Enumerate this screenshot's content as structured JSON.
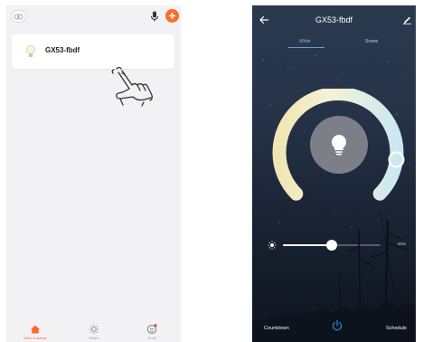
{
  "left_screen": {
    "device": {
      "name": "GX53-fbdf"
    },
    "nav": [
      {
        "label": "Mein Zuhause",
        "icon": "home-icon",
        "active": true
      },
      {
        "label": "Smart",
        "icon": "smart-icon",
        "active": false
      },
      {
        "label": "Profil",
        "icon": "profile-icon",
        "active": false
      }
    ]
  },
  "right_screen": {
    "title": "GX53-fbdf",
    "tabs": [
      "White",
      "Scene"
    ],
    "brightness": {
      "value": 0.5,
      "label": "50%"
    },
    "color_temperature": 0.86,
    "footer": {
      "countdown": "Countdown",
      "schedule": "Schedule"
    }
  },
  "colors": {
    "accent": "#ff6a2b",
    "ring_warm": "#f2e8b8",
    "ring_cool": "#cfe9f2"
  }
}
